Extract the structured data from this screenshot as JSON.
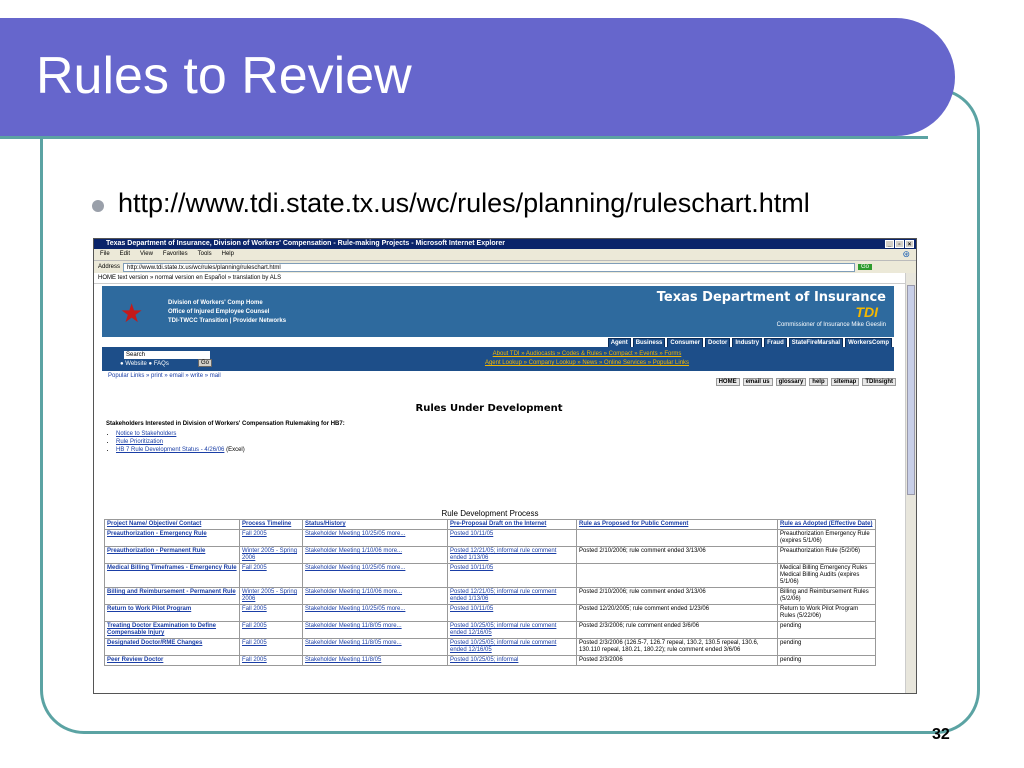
{
  "slide": {
    "title": "Rules to Review",
    "bullet": "http://www.tdi.state.tx.us/wc/rules/planning/ruleschart.html",
    "page_number": "32"
  },
  "browser": {
    "window_title": "Texas Department of Insurance, Division of Workers' Compensation - Rule-making Projects - Microsoft Internet Explorer",
    "menu": [
      "File",
      "Edit",
      "View",
      "Favorites",
      "Tools",
      "Help"
    ],
    "address_label": "Address",
    "address": "http://www.tdi.state.tx.us/wc/rules/planning/ruleschart.html",
    "go_label": "Go",
    "top_nav": "HOME   text version » normal version   en Español » translation by ALS",
    "header": {
      "left_line1": "Division of Workers' Comp Home",
      "left_line2": "Office of Injured Employee Counsel",
      "left_line3": "TDI-TWCC Transition  |  Provider Networks",
      "title": "Texas Department of Insurance",
      "abbr": "TDI",
      "commissioner": "Commissioner of Insurance Mike Geeslin"
    },
    "audience_tabs": [
      "Agent",
      "Business",
      "Consumer",
      "Doctor",
      "Industry",
      "Fraud",
      "StateFireMarshal",
      "WorkersComp"
    ],
    "search": {
      "label": "Search",
      "options": "● Website  ● FAQs",
      "go": "Go"
    },
    "blue_links_1": "About TDI » Audiocasts » Codes & Rules » Compact » Events » Forms",
    "blue_links_2": "Agent Lookup » Company Lookup » News » Online Services » Popular Links",
    "tool_icons": "Popular Links  » print » email » write » mail",
    "right_nav": [
      "HOME",
      "email us",
      "glossary",
      "help",
      "sitemap",
      "TDInsight"
    ],
    "heading": "Rules Under Development",
    "stakeholders_title": "Stakeholders Interested in Division of Workers' Compensation Rulemaking for HB7:",
    "stakeholder_links": [
      "Notice to Stakeholders",
      "Rule Prioritization",
      "HB 7 Rule Development Status - 4/26/06"
    ],
    "stakeholder_suffix": "(Excel)",
    "table_title": "Rule Development Process",
    "table": {
      "headers": [
        "Project Name/ Objective/ Contact",
        "Process Timeline",
        "Status/History",
        "Pre-Proposal Draft on the Internet",
        "Rule as Proposed for Public Comment",
        "Rule as Adopted (Effective Date)"
      ],
      "rows": [
        [
          "Preauthorization - Emergency Rule",
          "Fall 2005",
          "Stakeholder Meeting 10/25/05 more...",
          "Posted 10/11/05",
          "",
          "Preauthorization Emergency Rule (expires 5/1/06)"
        ],
        [
          "Preauthorization - Permanent Rule",
          "Winter 2005 - Spring 2006",
          "Stakeholder Meeting 1/10/06 more...",
          "Posted 12/21/05; informal rule comment ended 1/13/06",
          "Posted 2/10/2006; rule comment ended 3/13/06",
          "Preauthorization Rule (5/2/06)"
        ],
        [
          "Medical Billing Timeframes - Emergency Rule",
          "Fall 2005",
          "Stakeholder Meeting 10/25/05 more...",
          "Posted 10/11/05",
          "",
          "Medical Billing Emergency Rules Medical Billing Audits (expires 5/1/06)"
        ],
        [
          "Billing and Reimbursement - Permanent Rule",
          "Winter 2005 - Spring 2006",
          "Stakeholder Meeting 1/10/06 more...",
          "Posted 12/21/05; informal rule comment ended 1/13/06",
          "Posted 2/10/2006; rule comment ended 3/13/06",
          "Billing and Reimbursement Rules (5/2/06)"
        ],
        [
          "Return to Work Pilot Program",
          "Fall 2005",
          "Stakeholder Meeting 10/25/05 more...",
          "Posted 10/11/05",
          "Posted 12/20/2005; rule comment ended 1/23/06",
          "Return to Work Pilot Program Rules (5/22/06)"
        ],
        [
          "Treating Doctor Examination to Define Compensable Injury",
          "Fall 2005",
          "Stakeholder Meeting 11/8/05 more...",
          "Posted 10/25/05; informal rule comment ended 12/16/05",
          "Posted 2/3/2006; rule comment ended 3/6/06",
          "pending"
        ],
        [
          "Designated Doctor/RME Changes",
          "Fall 2005",
          "Stakeholder Meeting 11/8/05 more...",
          "Posted 10/25/05; informal rule comment ended 12/16/05",
          "Posted 2/3/2006 (126.5-7, 126.7 repeal, 130.2, 130.5 repeal, 130.6, 130.110 repeal, 180.21, 180.22); rule comment ended 3/6/06",
          "pending"
        ],
        [
          "Peer Review Doctor",
          "Fall 2005",
          "Stakeholder Meeting 11/8/05",
          "Posted 10/25/05; informal",
          "Posted 2/3/2006",
          "pending"
        ]
      ]
    }
  }
}
